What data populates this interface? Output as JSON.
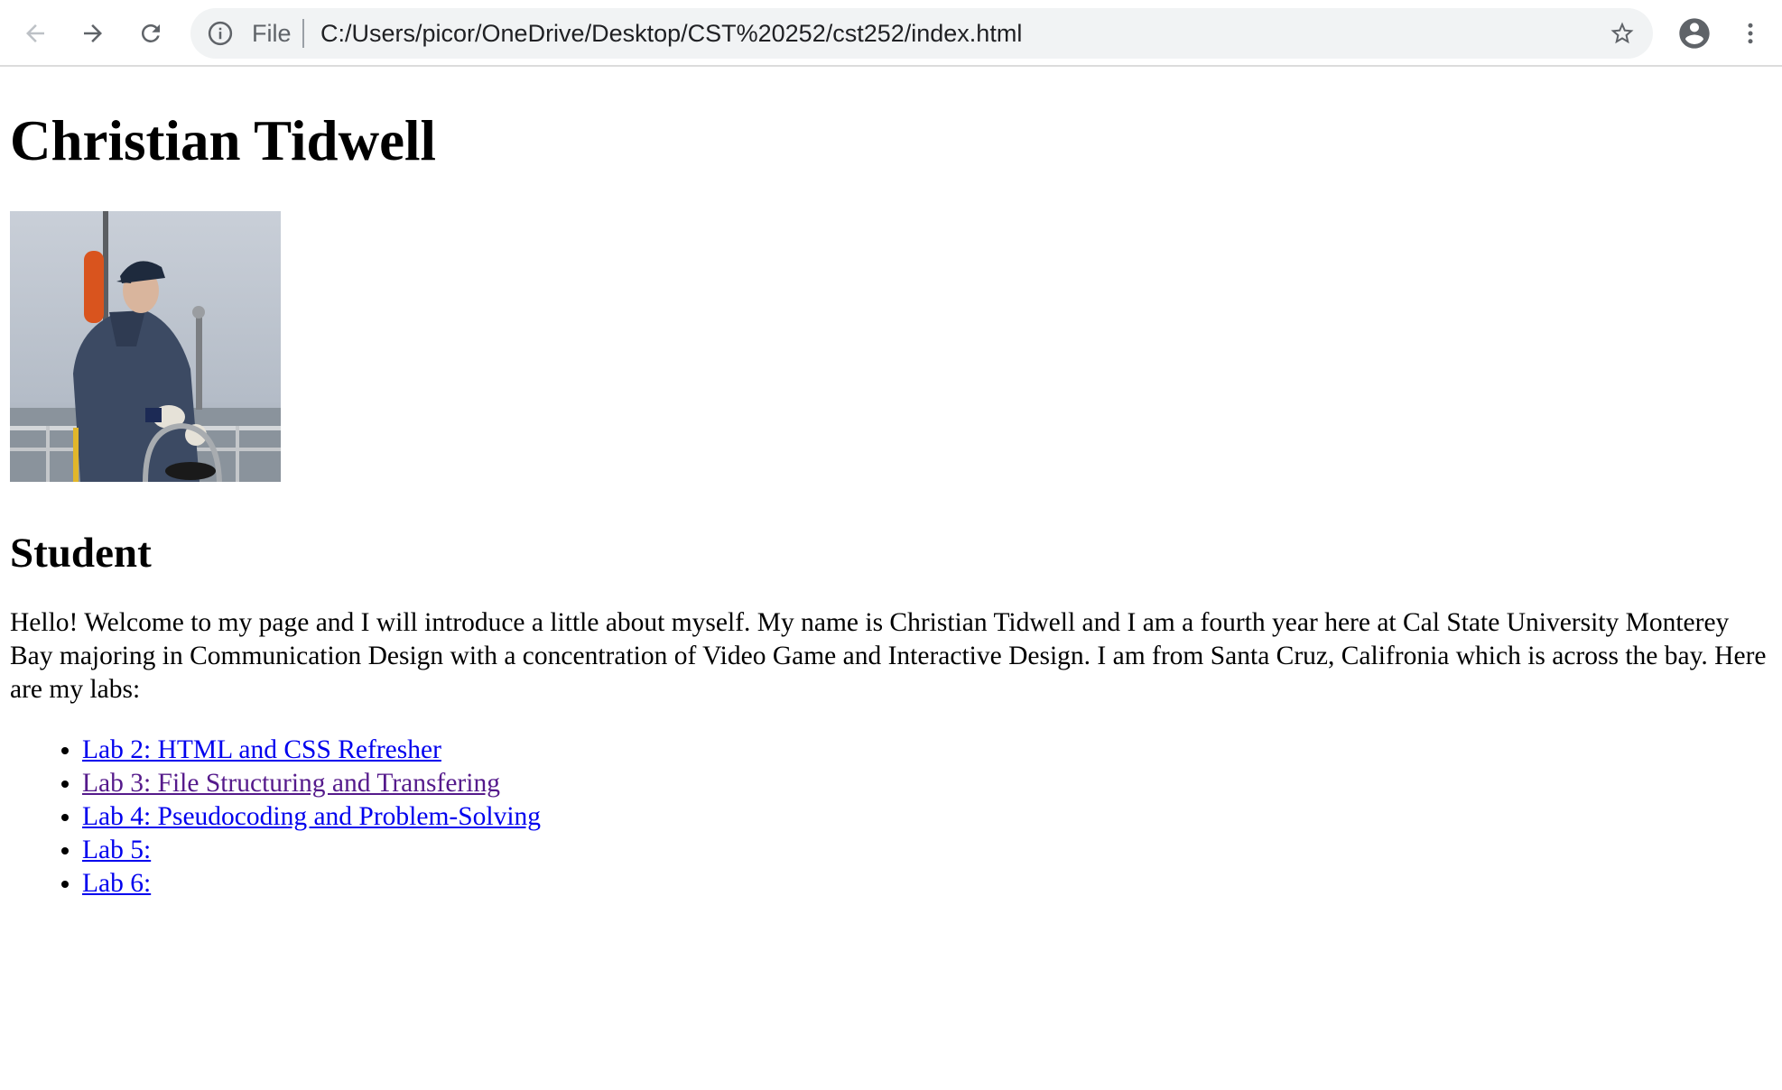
{
  "browser": {
    "scheme_label": "File",
    "url": "C:/Users/picor/OneDrive/Desktop/CST%20252/cst252/index.html",
    "icons": {
      "back": "arrow-left-icon",
      "forward": "arrow-right-icon",
      "reload": "reload-icon",
      "info": "info-icon",
      "bookmark": "star-icon",
      "profile": "account-circle-icon",
      "menu": "kebab-menu-icon"
    }
  },
  "page": {
    "heading": "Christian Tidwell",
    "photo_description": "portrait-photo",
    "subheading": "Student",
    "bio": "Hello! Welcome to my page and I will introduce a little about myself. My name is Christian Tidwell and I am a fourth year here at Cal State University Monterey Bay majoring in Communication Design with a concentration of Video Game and Interactive Design. I am from Santa Cruz, Califronia which is across the bay. Here are my labs:",
    "labs": [
      {
        "label": "Lab 2: HTML and CSS Refresher",
        "visited": false
      },
      {
        "label": "Lab 3: File Structuring and Transfering",
        "visited": true
      },
      {
        "label": "Lab 4: Pseudocoding and Problem-Solving",
        "visited": false
      },
      {
        "label": "Lab 5:",
        "visited": false
      },
      {
        "label": "Lab 6:",
        "visited": false
      }
    ]
  },
  "colors": {
    "link": "#0000ee",
    "link_visited": "#551a8b",
    "omnibox_bg": "#f1f3f4",
    "icon": "#5f6368"
  }
}
